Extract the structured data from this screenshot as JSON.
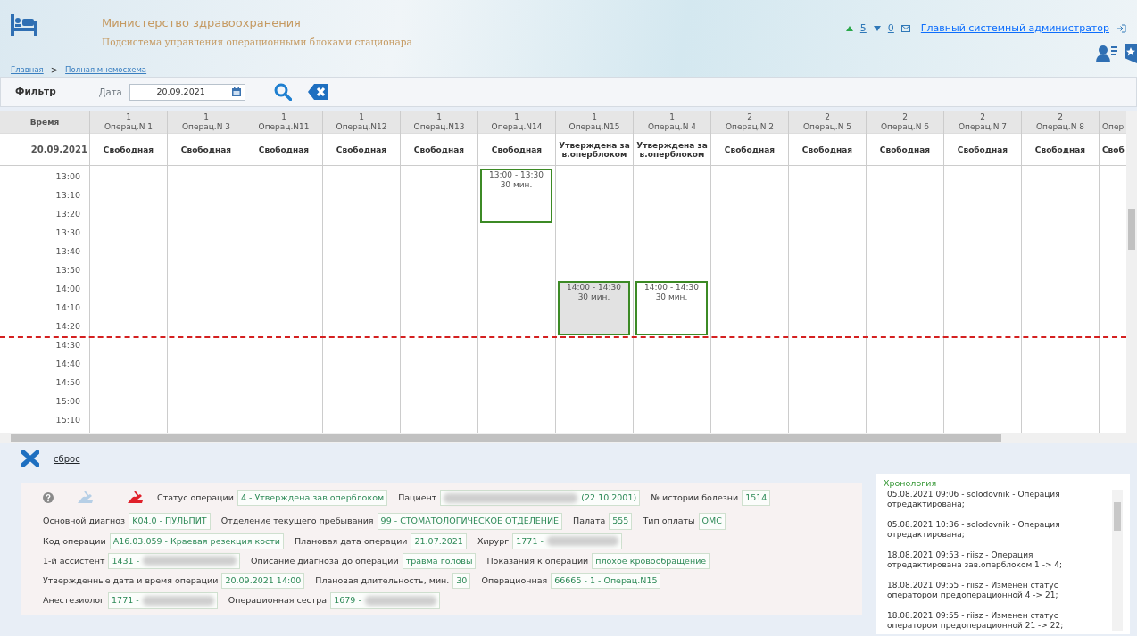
{
  "header": {
    "ministry": "Министерство здравоохранения",
    "subsystem": "Подсистема управления операционными блоками стационара"
  },
  "user_bar": {
    "up_count": "5",
    "down_count": "0",
    "user": "Главный системный администратор"
  },
  "breadcrumbs": [
    {
      "label": "Главная"
    },
    {
      "label": "Полная мнемосхема"
    }
  ],
  "breadcrumb_separator": ">",
  "filter": {
    "title": "Фильтр",
    "date_label": "Дата",
    "date_value": "20.09.2021"
  },
  "schedule": {
    "time_header": "Время",
    "date": "20.09.2021",
    "columns": [
      {
        "block": "1",
        "name": "Операц.N 1",
        "status": "Свободная"
      },
      {
        "block": "1",
        "name": "Операц.N 3",
        "status": "Свободная"
      },
      {
        "block": "1",
        "name": "Операц.N11",
        "status": "Свободная"
      },
      {
        "block": "1",
        "name": "Операц.N12",
        "status": "Свободная"
      },
      {
        "block": "1",
        "name": "Операц.N13",
        "status": "Свободная"
      },
      {
        "block": "1",
        "name": "Операц.N14",
        "status": "Свободная",
        "events": [
          {
            "time": "13:00 - 13:30",
            "duration": "30 мин.",
            "selected": false
          }
        ]
      },
      {
        "block": "1",
        "name": "Операц.N15",
        "status": "Утверждена зав.оперблоком",
        "events": [
          {
            "time": "14:00 - 14:30",
            "duration": "30 мин.",
            "selected": true
          }
        ]
      },
      {
        "block": "1",
        "name": "Операц.N 4",
        "status": "Утверждена зав.оперблоком",
        "events": [
          {
            "time": "14:00 - 14:30",
            "duration": "30 мин.",
            "selected": false
          }
        ]
      },
      {
        "block": "2",
        "name": "Операц.N 2",
        "status": "Свободная"
      },
      {
        "block": "2",
        "name": "Операц.N 5",
        "status": "Свободная"
      },
      {
        "block": "2",
        "name": "Операц.N 6",
        "status": "Свободная"
      },
      {
        "block": "2",
        "name": "Операц.N 7",
        "status": "Свободная"
      },
      {
        "block": "2",
        "name": "Операц.N 8",
        "status": "Свободная"
      },
      {
        "name": "Опер",
        "status": "Своб"
      }
    ],
    "times": [
      {
        "label": "13:00",
        "now_line": false
      },
      {
        "label": "13:10",
        "now_line": false
      },
      {
        "label": "13:20",
        "now_line": false
      },
      {
        "label": "13:30",
        "now_line": false
      },
      {
        "label": "13:40",
        "now_line": false
      },
      {
        "label": "13:50",
        "now_line": false
      },
      {
        "label": "14:00",
        "now_line": false
      },
      {
        "label": "14:10",
        "now_line": false
      },
      {
        "label": "14:20",
        "now_line": false
      },
      {
        "label": "14:30",
        "now_line": true
      },
      {
        "label": "14:40",
        "now_line": false
      },
      {
        "label": "14:50",
        "now_line": false
      },
      {
        "label": "15:00",
        "now_line": false
      },
      {
        "label": "15:10",
        "now_line": false
      }
    ]
  },
  "reset": {
    "label": "сброс"
  },
  "details": {
    "actions": [
      {
        "kind": "help"
      },
      {
        "kind": "sign",
        "disabled": true
      },
      {
        "kind": "sign",
        "disabled": false
      }
    ],
    "rows": [
      [
        {
          "label": "Статус операции",
          "value": "4 - Утверждена зав.оперблоком"
        },
        {
          "label": "Пациент",
          "value": "(22.10.2001)",
          "redacted_before": true
        },
        {
          "label": "№ истории болезни",
          "value": "1514"
        }
      ],
      [
        {
          "label": "Основной диагноз",
          "value": "K04.0 - ПУЛЬПИТ"
        },
        {
          "label": "Отделение текущего пребывания",
          "value": "99 - СТОМАТОЛОГИЧЕСКОЕ ОТДЕЛЕНИЕ"
        },
        {
          "label": "Палата",
          "value": "555"
        },
        {
          "label": "Тип оплаты",
          "value": "ОМС"
        }
      ],
      [
        {
          "label": "Код операции",
          "value": "A16.03.059 - Краевая резекция кости"
        },
        {
          "label": "Плановая дата операции",
          "value": "21.07.2021"
        },
        {
          "label": "Хирург",
          "value": "1771 -",
          "redacted_after": true
        }
      ],
      [
        {
          "label": "1-й ассистент",
          "value": "1431 -",
          "redacted_after": true
        },
        {
          "label": "Описание диагноза до операции",
          "value": "травма головы"
        },
        {
          "label": "Показания к операции",
          "value": "плохое кровообращение"
        }
      ],
      [
        {
          "label": "Утвержденные дата и время операции",
          "value": "20.09.2021 14:00"
        },
        {
          "label": "Плановая длительность, мин.",
          "value": "30"
        },
        {
          "label": "Операционная",
          "value": "66665 - 1 - Операц.N15"
        }
      ],
      [
        {
          "label": "Анестезиолог",
          "value": "1771 -",
          "redacted_after": true
        },
        {
          "label": "Операционная сестра",
          "value": "1679 -",
          "redacted_after": true
        }
      ]
    ]
  },
  "chronology": {
    "title": "Хронология",
    "entries": [
      "05.08.2021 09:06 - solodovnik - Операция отредактирована;",
      "05.08.2021 10:36 - solodovnik - Операция отредактирована;",
      "18.08.2021 09:53 - riisz - Операция отредактирована зав.оперблоком 1 -> 4;",
      "18.08.2021 09:55 - riisz - Изменен статус оператором предоперационной 4 -> 21;",
      "18.08.2021 09:55 - riisz - Изменен статус оператором предоперационной 21 -> 22;"
    ]
  }
}
